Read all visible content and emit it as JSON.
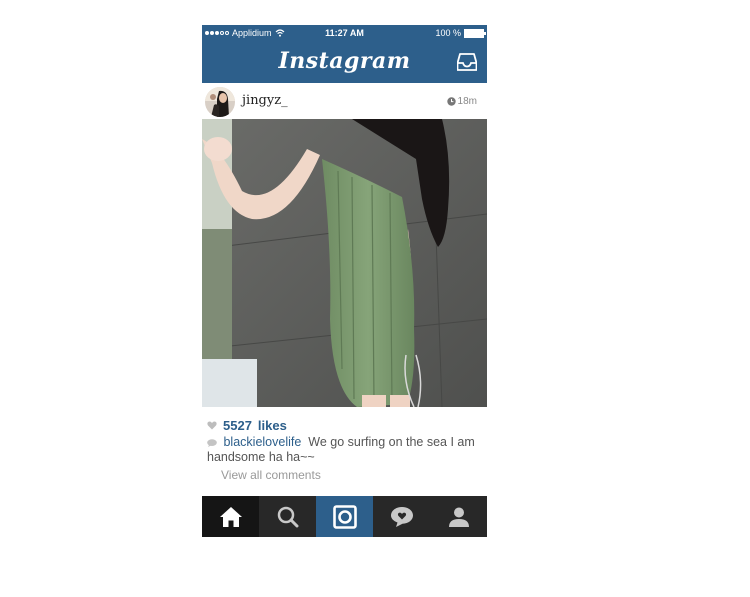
{
  "status_bar": {
    "carrier": "Applidium",
    "time": "11:27 AM",
    "battery_text": "100 %",
    "battery_level": 1.0
  },
  "app": {
    "title": "Instagram",
    "inbox_icon": "inbox-tray-icon"
  },
  "post": {
    "username": "jingyz_",
    "time_ago": "18m",
    "likes_count": "5527",
    "likes_label": "likes",
    "caption_user": "blackielovelife",
    "caption_text": "We go surfing on the sea I am handsome ha ha~~",
    "view_all_comments": "View all comments"
  },
  "tabbar": {
    "tabs": [
      {
        "icon": "home-icon",
        "active": true
      },
      {
        "icon": "search-icon",
        "active": false
      },
      {
        "icon": "camera-icon",
        "active": false
      },
      {
        "icon": "activity-heart-icon",
        "active": false
      },
      {
        "icon": "profile-icon",
        "active": false
      }
    ]
  },
  "colors": {
    "accent": "#2d5f8b",
    "tabbar_bg": "#282828",
    "tab_active_bg": "#151515",
    "dress": "#7c9a6e"
  }
}
